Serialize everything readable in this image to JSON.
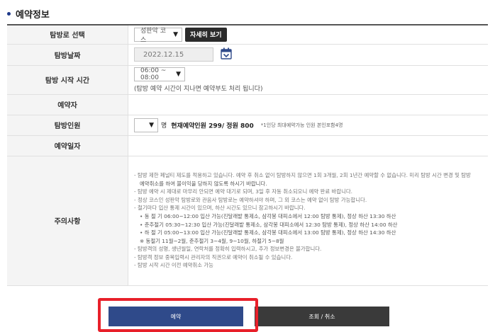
{
  "section": {
    "title": "예약정보"
  },
  "rows": {
    "course": {
      "label": "탐방로 선택",
      "selected": "성판악 코스",
      "detail_button": "자세히 보기"
    },
    "date": {
      "label": "탐방날짜",
      "value": "2022.12.15"
    },
    "start_time": {
      "label": "탐방 시작 시간",
      "selected": "06:00 ~ 08:00",
      "note": "(탐방 예약 시간이 지나면 예약부도 처리 됩니다)"
    },
    "reserver": {
      "label": "예약자"
    },
    "people": {
      "label": "탐방인원",
      "unit": "명",
      "count": "현재예약인원 299/ 정원 800",
      "note": "*1인당 최대예약가능 인원 본인포함4명"
    },
    "reserve_date": {
      "label": "예약일자"
    },
    "notice": {
      "label": "주의사항",
      "items": [
        {
          "text": "- 탐방 제한 페널티 제도를 적용하고 있습니다. 예약 후 취소 없이 탐방하지 않으면 1회 3개월, 2회 1년간 예약할 수 없습니다. 미리 탐방 시간 변경 및 탐방",
          "sub": false
        },
        {
          "text": "예약취소를 하여 불이익을 당하지 않도록 하시기 바랍니다.",
          "sub": true
        },
        {
          "text": "- 탐방 예약 시 제대로 마무리 안되면 예약 대기로 되며, 3일 후 자동 취소되오니 예약 완료 바랍니다.",
          "sub": false
        },
        {
          "text": "- 정상 코스인 성판악 탐방로와 관음사 탐방로는 예약하셔야 하며, 그 외 코스는 예약 없이 탐방 가능합니다.",
          "sub": false
        },
        {
          "text": "- 철기마다 입산 통제 시간이 있으며, 하산 시간도 있으니 참고하시기 바랍니다.",
          "sub": false
        },
        {
          "text": "• 동 절 기 06:00~12:00 입산 가능(진달래밭 통제소, 삼각봉 대피소에서 12:00 탐방 통제), 정상 하산 13:30 하산",
          "sub": true
        },
        {
          "text": "• 춘추절기 05:30~12:30 입산 가능(진달래밭 통제소, 삼각봉 대피소에서 12:30 탐방 통제), 정상 하산 14:00 하산",
          "sub": true
        },
        {
          "text": "• 하 절 기 05:00~13:00 입산 가능(진달래밭 통제소, 삼각봉 대피소에서 13:00 탐방 통제), 정상 하산 14:30 하산",
          "sub": true
        },
        {
          "text": "※ 동절기 11월~2월, 춘추절기 3~4월, 9~10월, 하절기 5~8월",
          "sub": true
        },
        {
          "text": "- 탐방객의 성명, 생년월일, 연락처를 정확히 입력하시고, 추가 정보변경은 불가합니다.",
          "sub": false
        },
        {
          "text": "- 탐방객 정보 중복입력시 관리자의 직권으로 예약이 취소될 수 있습니다.",
          "sub": false
        },
        {
          "text": "- 탐방 시작 시간 이전 예약취소 가능",
          "sub": false
        }
      ]
    }
  },
  "buttons": {
    "reserve": "예약",
    "lookup_cancel": "조회 / 취소"
  },
  "colors": {
    "accent": "#2f4a8a",
    "highlight": "#e8202a"
  }
}
